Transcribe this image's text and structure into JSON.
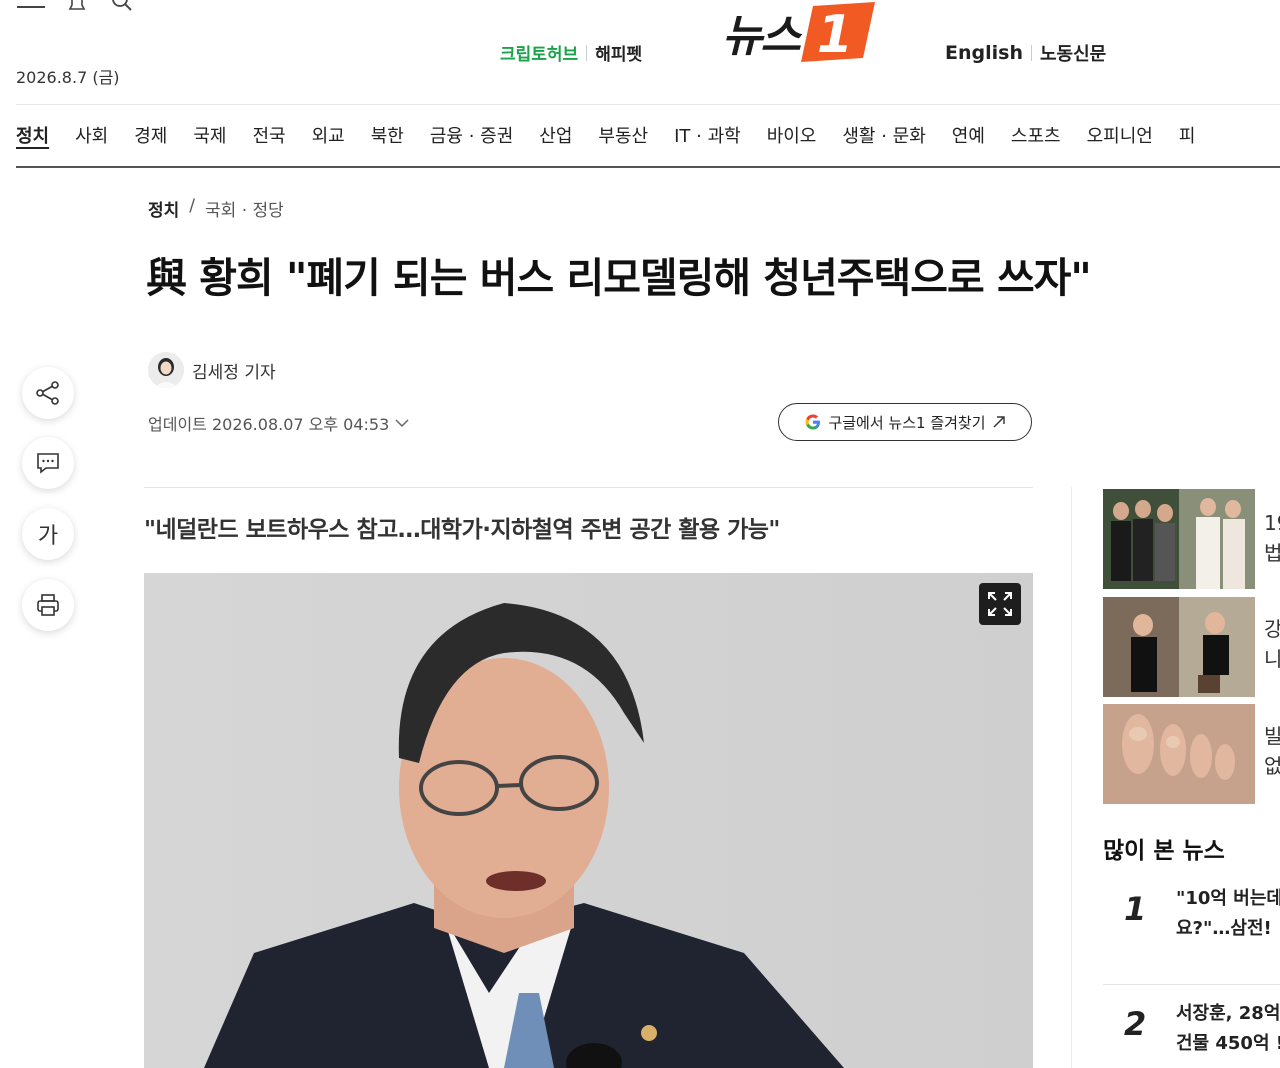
{
  "header": {
    "date": "2026.8.7 (금)",
    "partner_links": [
      "크립토허브",
      "해피펫"
    ],
    "logo_text": "뉴스",
    "logo_badge": "1",
    "lang_links": [
      "English",
      "노동신문"
    ]
  },
  "nav": {
    "items": [
      "정치",
      "사회",
      "경제",
      "국제",
      "전국",
      "외교",
      "북한",
      "금융 · 증권",
      "산업",
      "부동산",
      "IT · 과학",
      "바이오",
      "생활 · 문화",
      "연예",
      "스포츠",
      "오피니언",
      "피"
    ],
    "active": "정치"
  },
  "article": {
    "breadcrumb_section": "정치",
    "breadcrumb_sep": "/",
    "breadcrumb_sub": "국회 · 정당",
    "headline": "與 황희 \"폐기 되는 버스 리모델링해 청년주택으로 쓰자\"",
    "author": "김세정 기자",
    "updated": "업데이트 2026.08.07 오후 04:53",
    "google_button": "구글에서 뉴스1 즐겨찾기",
    "subhead": "\"네덜란드 보트하우스 참고…대학가·지하철역 주변 공간 활용 가능\""
  },
  "sidebar": {
    "buttons": [
      "share-icon",
      "comment-icon",
      "font-size-icon",
      "print-icon"
    ],
    "font_size_label": "가"
  },
  "right_column": {
    "thumb_texts": [
      [
        "19",
        "법"
      ],
      [
        "강",
        "니"
      ],
      [
        "빌",
        "없"
      ]
    ],
    "popular_title": "많이 본 뉴스",
    "popular": [
      {
        "rank": "1",
        "line1": "\"10억 버는데",
        "line2": "요?\"…삼전!"
      },
      {
        "rank": "2",
        "line1": "서장훈, 28억",
        "line2": "건물 450억 !"
      }
    ]
  },
  "colors": {
    "accent_orange": "#f15a22",
    "crypto_green": "#1aa34a",
    "text_dark": "#111111"
  }
}
